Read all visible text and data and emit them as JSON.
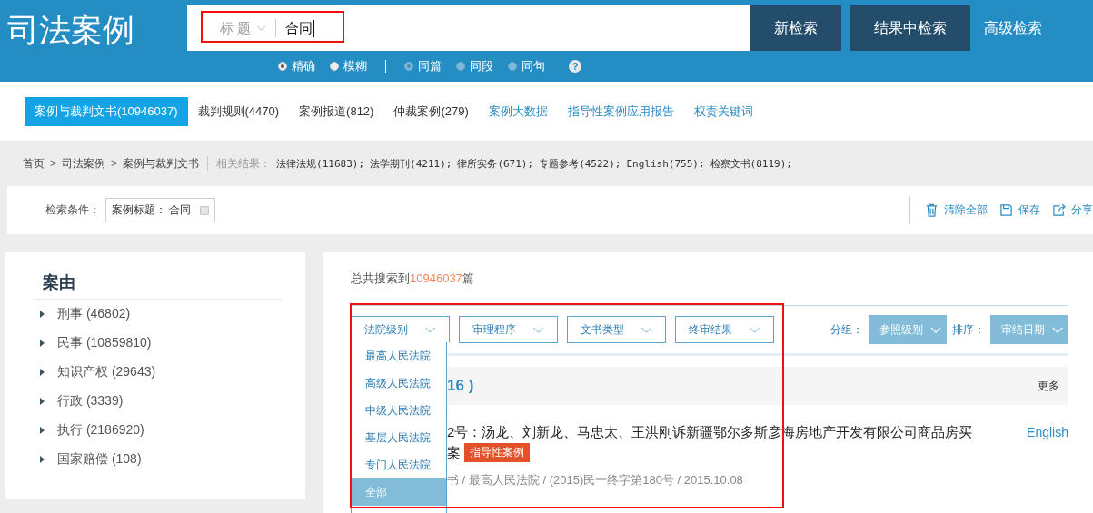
{
  "header": {
    "logo": "司法案例",
    "search": {
      "field_selector": "标 题",
      "value": "合同"
    },
    "buttons": [
      "新检索",
      "结果中检索"
    ],
    "advanced_link": "高级检索",
    "match_options": [
      {
        "label": "精确",
        "selected": true
      },
      {
        "label": "模糊",
        "selected": false
      }
    ],
    "scope_options": [
      {
        "label": "同篇",
        "selected": true,
        "disabled": true
      },
      {
        "label": "同段",
        "selected": false,
        "disabled": true
      },
      {
        "label": "同句",
        "selected": false,
        "disabled": true
      }
    ],
    "help": "?"
  },
  "tabs": [
    {
      "label": "案例与裁判文书(10946037)",
      "selected": true,
      "kind": "category"
    },
    {
      "label": "裁判规则(4470)",
      "selected": false,
      "kind": "category"
    },
    {
      "label": "案例报道(812)",
      "selected": false,
      "kind": "category"
    },
    {
      "label": "仲裁案例(279)",
      "selected": false,
      "kind": "category"
    },
    {
      "label": "案例大数据",
      "selected": false,
      "kind": "link"
    },
    {
      "label": "指导性案例应用报告",
      "selected": false,
      "kind": "link"
    },
    {
      "label": "权责关键词",
      "selected": false,
      "kind": "link"
    }
  ],
  "breadcrumb": [
    {
      "label": "首页"
    },
    {
      "separator": ">",
      "label": "司法案例"
    },
    {
      "separator": ">",
      "label": "案例与裁判文书"
    }
  ],
  "related": {
    "label": "相关结果：",
    "items": [
      "法律法规(11683);",
      "法学期刊(4211);",
      "律所实务(671);",
      "专题参考(4522);",
      "English(755);",
      "检察文书(8119);"
    ]
  },
  "criteria": {
    "label": "检索条件：",
    "tags": [
      "案例标题： 合同"
    ],
    "actions": [
      {
        "label": "清除全部",
        "kind": "clear"
      },
      {
        "label": "保存",
        "kind": "save"
      },
      {
        "label": "分享",
        "kind": "share"
      }
    ]
  },
  "sidebar": {
    "title": "案由",
    "items": [
      "刑事 (46802)",
      "民事 (10859810)",
      "知识产权 (29643)",
      "行政 (3339)",
      "执行 (2186920)",
      "国家赔偿 (108)"
    ]
  },
  "results": {
    "total_prefix": "总共搜索到",
    "total": "10946037",
    "total_suffix": "篇",
    "filters": [
      {
        "label": "法院级别",
        "expanded": true
      },
      {
        "label": "审理程序",
        "expanded": false
      },
      {
        "label": "文书类型",
        "expanded": false
      },
      {
        "label": "终审结果",
        "expanded": false
      }
    ],
    "dropdown_options": [
      {
        "label": "最高人民法院",
        "selected": false
      },
      {
        "label": "高级人民法院",
        "selected": false
      },
      {
        "label": "中级人民法院",
        "selected": false
      },
      {
        "label": "基层人民法院",
        "selected": false
      },
      {
        "label": "专门人民法院",
        "selected": false
      },
      {
        "label": "全部",
        "selected": true
      }
    ],
    "group_label": "分组：",
    "group_value": "参照级别",
    "sort_label": "排序：",
    "sort_value": "审结日期",
    "group_header": "16 )",
    "more": "更多",
    "case": {
      "title": "2号：汤龙、刘新龙、马忠太、王洪刚诉新疆鄂尔多斯彦海房地产开发有限公司商品房买",
      "title_end": "案",
      "tag": "指导性案例",
      "english": "English",
      "meta": "书 / 最高人民法院 / (2015)民一终字第180号 / 2015.10.08"
    }
  }
}
